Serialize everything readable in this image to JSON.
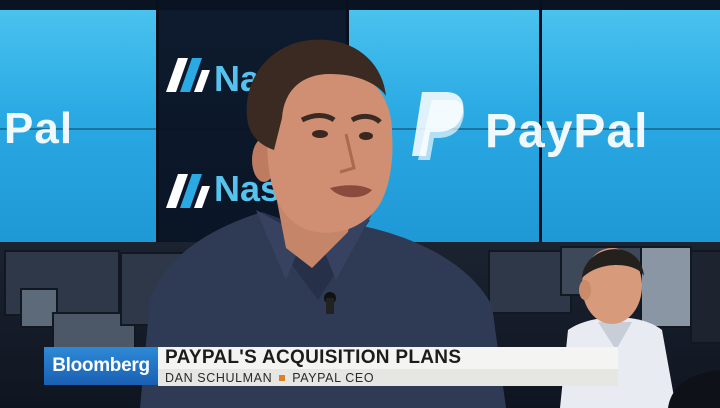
{
  "video_wall": {
    "brand_left": "Pal",
    "brand_right": "PayPal",
    "exchange_top": "Nas",
    "exchange_bottom": "Nas"
  },
  "lower_third": {
    "network": "Bloomberg",
    "headline": "PAYPAL'S ACQUISITION PLANS",
    "name": "DAN SCHULMAN",
    "role": "PAYPAL CEO"
  },
  "colors": {
    "screen_blue": "#2aa9e3",
    "network_blue": "#1a5fb3",
    "separator": "#d9822b",
    "shirt": "#2f3a55"
  }
}
